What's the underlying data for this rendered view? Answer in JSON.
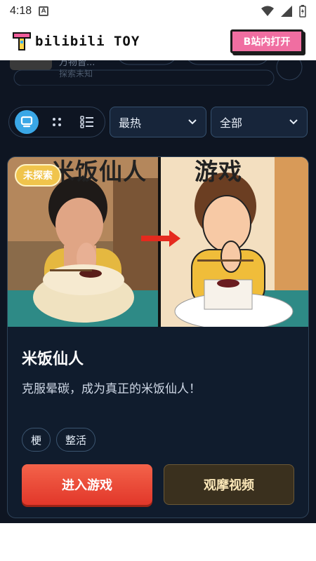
{
  "status_bar": {
    "time": "4:18",
    "notification_icon": "a-icon"
  },
  "header": {
    "logo_text": "bilibili TOY",
    "open_button": "B站内打开"
  },
  "partial_top": {
    "text1": "万物皆...",
    "text2": "探索未知"
  },
  "controls": {
    "sort_value": "最热",
    "filter_value": "全部"
  },
  "card": {
    "tag": "未探索",
    "image_caption_left": "米饭仙人",
    "image_caption_right": "游戏",
    "title": "米饭仙人",
    "description": "克服晕碳，成为真正的米饭仙人！",
    "tags": [
      "梗",
      "整活"
    ],
    "enter_button": "进入游戏",
    "watch_button": "观摩视频"
  },
  "colors": {
    "app_bg": "#0e1522",
    "accent": "#3aa7e6",
    "enter_btn": "#e8442f",
    "brand_pink": "#f06ea1"
  }
}
